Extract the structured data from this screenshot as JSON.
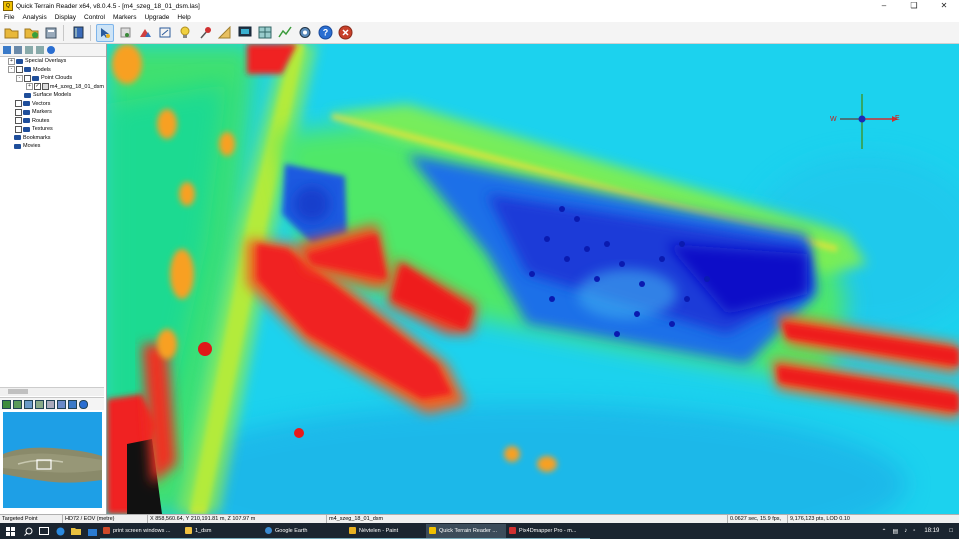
{
  "window": {
    "title": "Quick Terrain Reader x64, v8.0.4.5 - [m4_szeg_18_01_dsm.las]",
    "app_icon_letter": "Q",
    "controls": [
      "minimize-icon",
      "maximize-icon",
      "close-icon"
    ]
  },
  "menu": [
    "File",
    "Analysis",
    "Display",
    "Control",
    "Markers",
    "Upgrade",
    "Help"
  ],
  "toolbar": {
    "icons": [
      "open-folder-icon",
      "add-folder-icon",
      "database-icon",
      "book-icon",
      "select-cursor-icon",
      "layers-icon",
      "chart-icon",
      "zoom-icon",
      "light-icon",
      "marker-pin-icon",
      "ruler-icon",
      "monitor-icon",
      "grid-icon",
      "profile-icon",
      "record-icon",
      "help-icon",
      "stop-icon"
    ],
    "accent_help": "#2a6ed1",
    "accent_stop": "#c8402a"
  },
  "tree": {
    "items": [
      {
        "label": "Special Overlays",
        "indent": 0,
        "expander": "+",
        "checkbox": false
      },
      {
        "label": "Models",
        "indent": 0,
        "expander": "-",
        "checkbox": true
      },
      {
        "label": "Point Clouds",
        "indent": 1,
        "expander": "-",
        "checkbox": true
      },
      {
        "label": "m4_szeg_18_01_dsm",
        "indent": 2,
        "expander": "+",
        "checkbox": true
      },
      {
        "label": "Surface Models",
        "indent": 1,
        "expander": "",
        "checkbox": false
      },
      {
        "label": "Vectors",
        "indent": 0,
        "expander": "",
        "checkbox": true
      },
      {
        "label": "Markers",
        "indent": 0,
        "expander": "",
        "checkbox": true
      },
      {
        "label": "Routes",
        "indent": 0,
        "expander": "",
        "checkbox": true
      },
      {
        "label": "Textures",
        "indent": 0,
        "expander": "",
        "checkbox": true
      },
      {
        "label": "Bookmarks",
        "indent": 0,
        "expander": "",
        "checkbox": false
      },
      {
        "label": "Movies",
        "indent": 0,
        "expander": "",
        "checkbox": false
      }
    ]
  },
  "compass": {
    "west": "W",
    "east": "E"
  },
  "status": {
    "mode": "Targeted Point",
    "crs": "HD72 / EOV (metre)",
    "coords": "X 858,560.64, Y 210,191.81 m, Z 107.97 m",
    "file": "m4_szeg_18_01_dsm",
    "timing": "0.0627 sec, 15.9 fps,",
    "points": "9,176,123 pts, LOD 0.10"
  },
  "taskbar": {
    "items": [
      {
        "label": "print screen windows ...",
        "icon_color": "#d04a2a",
        "active": false
      },
      {
        "label": "1_dsm",
        "icon_color": "#f0c040",
        "active": false
      },
      {
        "label": "Google Earth",
        "icon_color": "#3a8ad0",
        "active": false
      },
      {
        "label": "Névtelen - Paint",
        "icon_color": "#e8b020",
        "active": false
      },
      {
        "label": "Quick Terrain Reader ...",
        "icon_color": "#f0c000",
        "active": true
      },
      {
        "label": "Pix4Dmapper Pro - m...",
        "icon_color": "#d03030",
        "active": false
      }
    ],
    "clock": "18:19"
  }
}
